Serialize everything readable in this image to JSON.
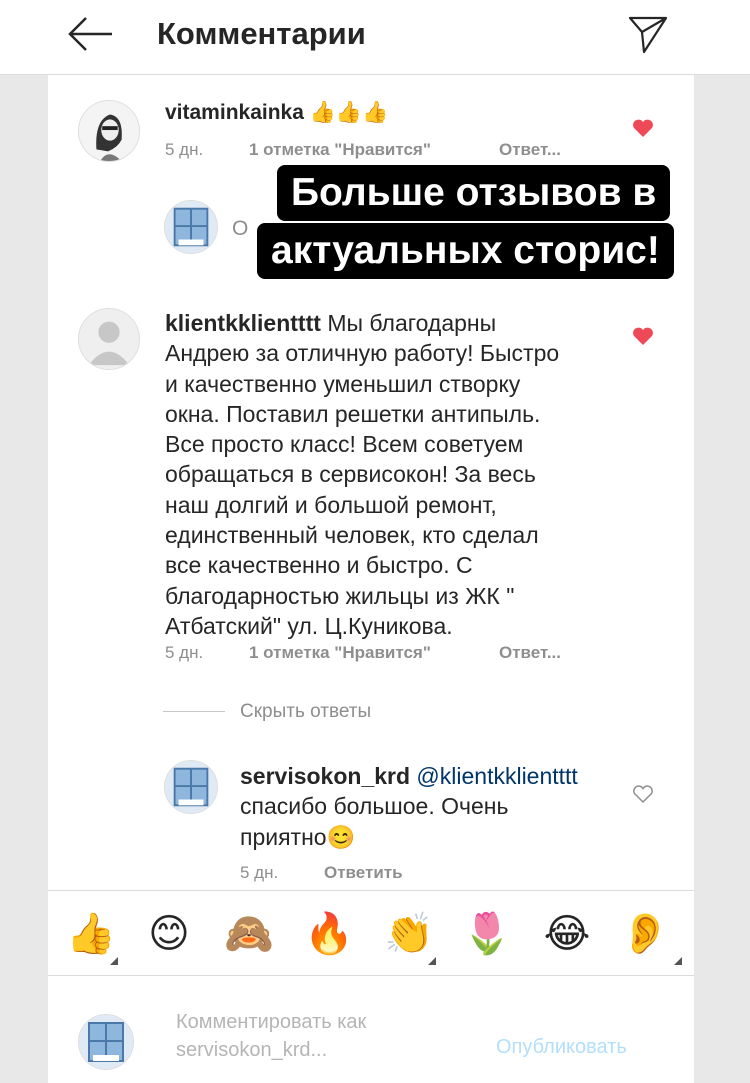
{
  "header": {
    "title": "Комментарии"
  },
  "banner": {
    "line1": "Больше отзывов в",
    "line2": "актуальных сторис!"
  },
  "comments": [
    {
      "username": "vitaminkainka",
      "text": "👍👍👍",
      "time": "5 дн.",
      "likes": "1 отметка \"Нравится\"",
      "reply": "Ответ..."
    },
    {
      "partial_text": "О"
    },
    {
      "username": "klientkklientttt",
      "text_lines": [
        "Мы благодарны",
        "Андрею за отличную работу! Быстро",
        "и качественно  уменьшил створку",
        "окна. Поставил решетки антипыль.",
        "Все просто класс! Всем советуем",
        "обращаться в сервисокон! За весь",
        "наш долгий и большой ремонт,",
        "единственный человек, кто сделал",
        "все качественно и быстро. С",
        "благодарностью жильцы из ЖК \"",
        "Атбатский\" ул. Ц.Куникова."
      ],
      "time": "5 дн.",
      "likes": "1 отметка \"Нравится\"",
      "reply": "Ответ..."
    }
  ],
  "hide_replies": "Скрыть ответы",
  "reply_comment": {
    "username": "servisokon_krd",
    "mention": "@klientkklientttt",
    "text_line1": "спасибо большое. Очень",
    "text_line2": "приятно😊",
    "time": "5 дн.",
    "reply": "Ответить"
  },
  "emoji_bar": [
    "👍",
    "😊",
    "🙈",
    "🔥",
    "👏",
    "🌷",
    "😂",
    "👂"
  ],
  "composer": {
    "placeholder_line1": "Комментировать как",
    "placeholder_line2": "servisokon_krd...",
    "publish_label": "Опубликовать"
  },
  "colors": {
    "heart": "#ed4956",
    "meta_gray": "#8e8e8e",
    "publish_blue": "#b2dffc"
  }
}
